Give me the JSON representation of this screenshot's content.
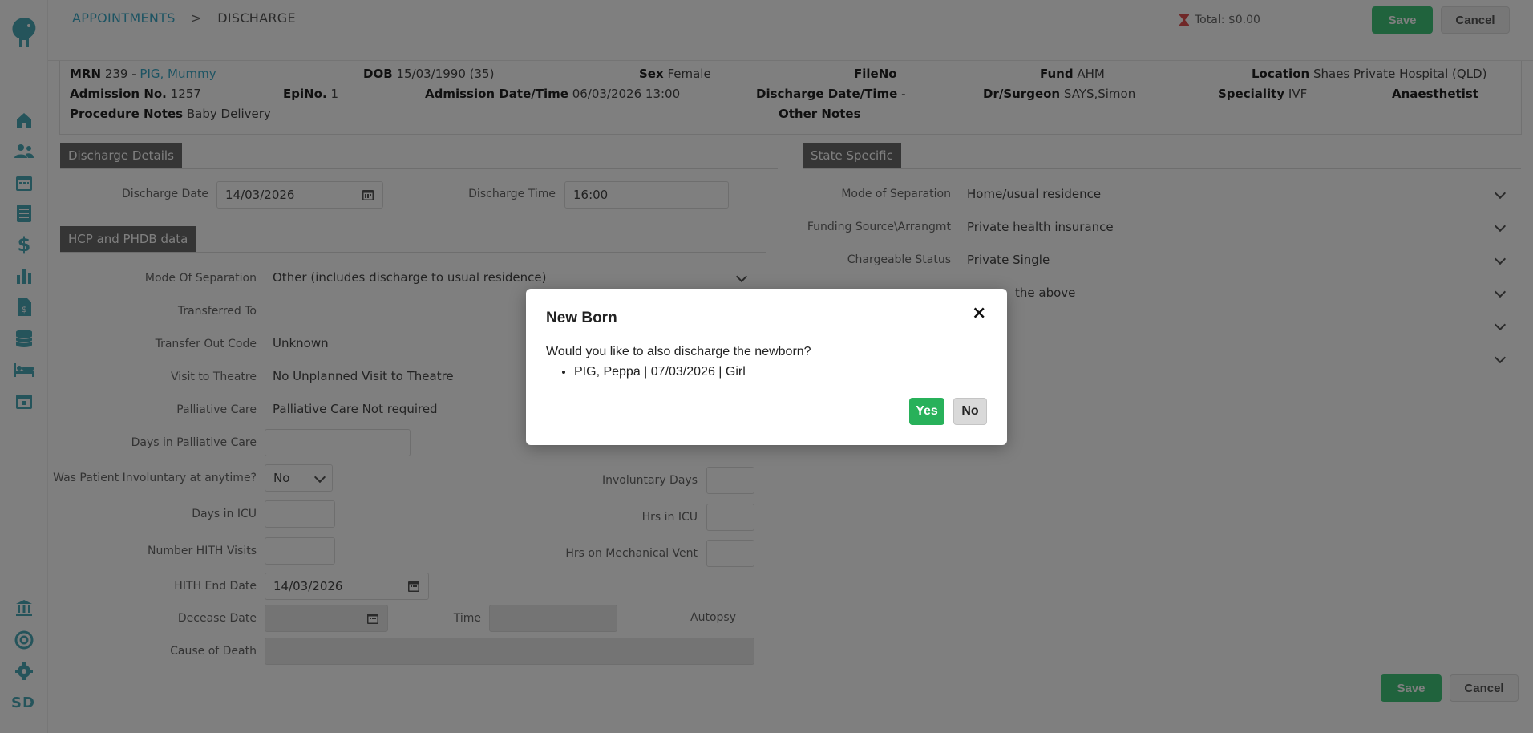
{
  "breadcrumb": {
    "parent": "APPOINTMENTS",
    "separator": ">",
    "current": "DISCHARGE"
  },
  "header": {
    "total": "Total: $0.00",
    "save": "Save",
    "cancel": "Cancel"
  },
  "sidebar": {
    "initials": "SD"
  },
  "patient": {
    "mrn_label": "MRN",
    "mrn_value": "239 -",
    "name": "PIG, Mummy",
    "dob_label": "DOB",
    "dob_value": "15/03/1990 (35)",
    "sex_label": "Sex",
    "sex_value": "Female",
    "fileno_label": "FileNo",
    "fund_label": "Fund",
    "fund_value": "AHM",
    "location_label": "Location",
    "location_value": "Shaes Private Hospital (QLD)",
    "admno_label": "Admission No.",
    "admno_value": "1257",
    "epino_label": "EpiNo.",
    "epino_value": "1",
    "admdt_label": "Admission Date/Time",
    "admdt_value": "06/03/2026 13:00",
    "disdt_label": "Discharge Date/Time",
    "disdt_value": "-",
    "surgeon_label": "Dr/Surgeon",
    "surgeon_value": "SAYS,Simon",
    "speciality_label": "Speciality",
    "speciality_value": "IVF",
    "anaesthetist_label": "Anaesthetist",
    "procnotes_label": "Procedure Notes",
    "procnotes_value": "Baby Delivery",
    "othernotes_label": "Other Notes"
  },
  "discharge_details": {
    "heading": "Discharge Details",
    "date_label": "Discharge Date",
    "date_value": "14/03/2026",
    "time_label": "Discharge Time",
    "time_value": "16:00"
  },
  "hcp": {
    "heading": "HCP and PHDB data",
    "mode_label": "Mode Of Separation",
    "mode_value": "Other (includes discharge to usual residence)",
    "transferred_label": "Transferred To",
    "transfer_out_label": "Transfer Out Code",
    "transfer_out_value": "Unknown",
    "theatre_label": "Visit to Theatre",
    "theatre_value": "No Unplanned Visit to Theatre",
    "palliative_label": "Palliative Care",
    "palliative_value": "Palliative Care Not required",
    "days_palliative_label": "Days in Palliative Care",
    "involuntary_label": "Was Patient Involuntary at anytime?",
    "involuntary_value": "No",
    "involuntary_days_label": "Involuntary Days",
    "icu_days_label": "Days in ICU",
    "icu_hrs_label": "Hrs in ICU",
    "hith_visits_label": "Number HITH Visits",
    "mech_vent_label": "Hrs on Mechanical Vent",
    "hith_end_label": "HITH End Date",
    "hith_end_value": "14/03/2026",
    "decease_label": "Decease Date",
    "time_label": "Time",
    "autopsy_label": "Autopsy",
    "cause_label": "Cause of Death"
  },
  "state_specific": {
    "heading": "State Specific",
    "mode_label": "Mode of Separation",
    "mode_value": "Home/usual residence",
    "funding_label": "Funding Source\\Arrangmt",
    "funding_value": "Private health insurance",
    "chargeable_label": "Chargeable Status",
    "chargeable_value": "Private Single",
    "row4_value": "the above"
  },
  "footer": {
    "save": "Save",
    "cancel": "Cancel"
  },
  "modal": {
    "title": "New Born",
    "close": "×",
    "message": "Would you like to also discharge the newborn?",
    "items": [
      "PIG, Peppa | 07/03/2026 | Girl"
    ],
    "yes": "Yes",
    "no": "No"
  },
  "colors": {
    "accent": "#3ba8c6",
    "save_green": "#41c67b",
    "yes_green": "#28b15a",
    "section_gray": "#6b6b6b"
  }
}
